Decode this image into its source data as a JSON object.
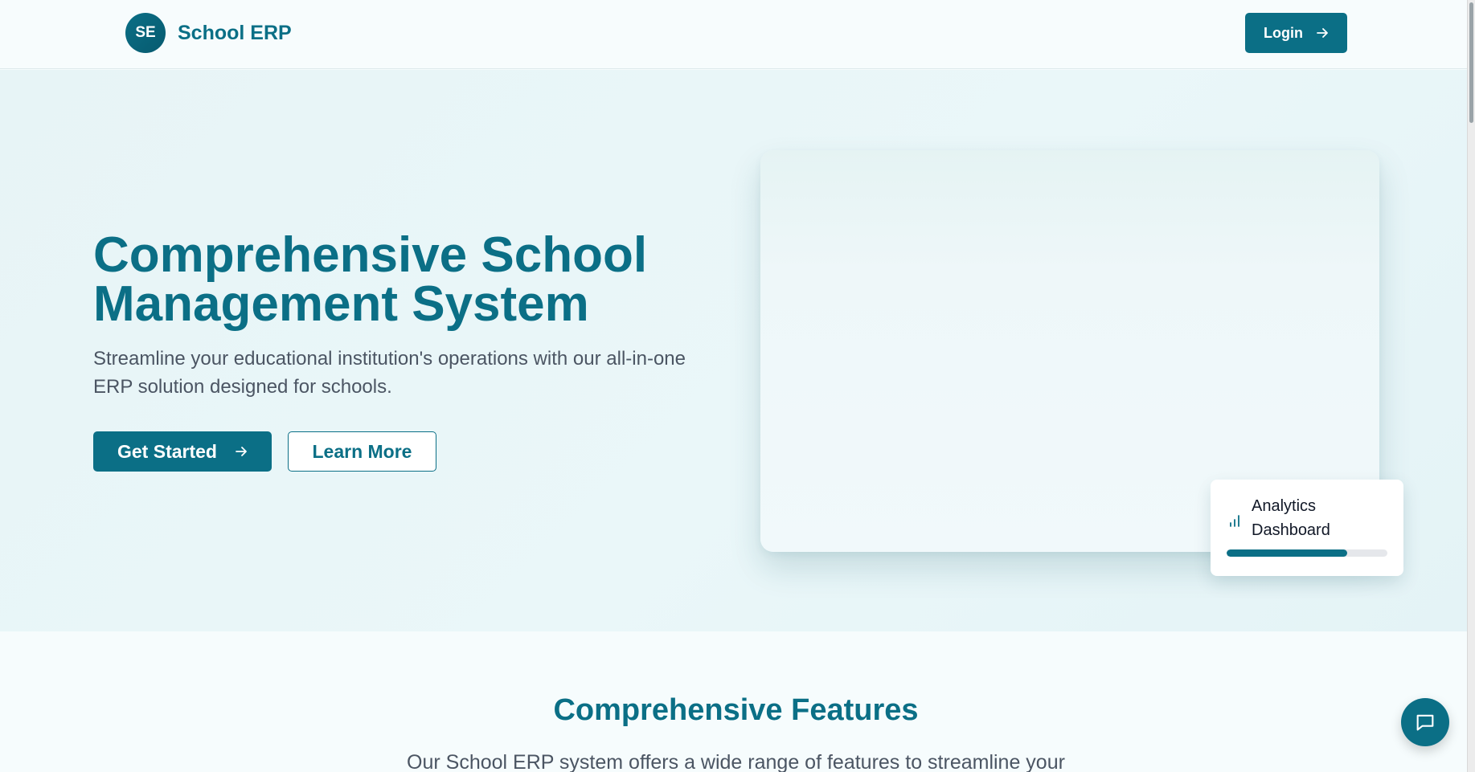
{
  "header": {
    "brand_initials": "SE",
    "brand_name": "School ERP",
    "login_label": "Login"
  },
  "hero": {
    "title": "Comprehensive School Management System",
    "subtitle": "Streamline your educational institution's operations with our all-in-one ERP solution designed for schools.",
    "primary_cta": "Get Started",
    "secondary_cta": "Learn More",
    "analytics_card": {
      "label": "Analytics Dashboard",
      "icon": "bar-chart-icon",
      "progress_percent": 75
    }
  },
  "features": {
    "title": "Comprehensive Features",
    "subtitle": "Our School ERP system offers a wide range of features to streamline your"
  },
  "chat": {
    "icon": "chat-bubble-icon"
  },
  "colors": {
    "accent": "#0b6f86",
    "hero_bg": "#e8f5f7",
    "page_bg": "#f6fcfd",
    "text_muted": "#4b5563"
  }
}
